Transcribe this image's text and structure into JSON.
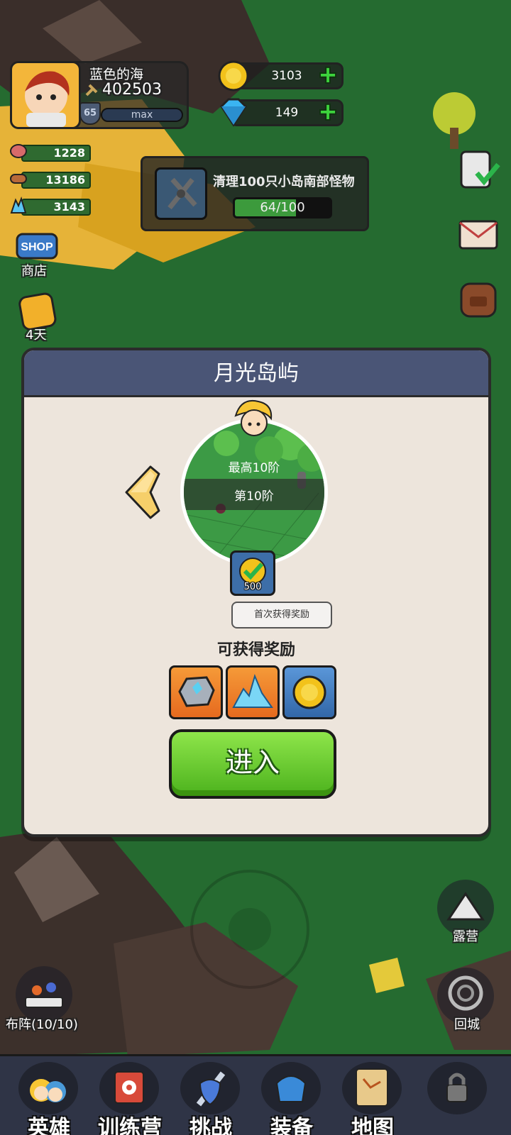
{
  "player": {
    "name": "蓝色的海",
    "power": "402503",
    "level": "65",
    "exp_label": "max"
  },
  "currencies": {
    "gold": "3103",
    "gems": "149"
  },
  "resources": [
    {
      "value": "1228",
      "icon": "meat-icon"
    },
    {
      "value": "13186",
      "icon": "wood-icon"
    },
    {
      "value": "3143",
      "icon": "crystal-icon"
    }
  ],
  "quest": {
    "title": "清理100只小岛南部怪物",
    "progress_label": "64/100",
    "progress_fraction": 0.64
  },
  "side_left": {
    "shop_label": "商店",
    "pass_label": "4天"
  },
  "side_right": {
    "camp_label": "露营",
    "return_label": "回城"
  },
  "formation_label": "布阵(10/10)",
  "modal": {
    "title": "月光岛屿",
    "max_stage": "最高10阶",
    "current_stage": "第10阶",
    "first_reward_count": "500",
    "first_reward_label": "首次获得奖励",
    "rewards_title": "可获得奖励",
    "rewards": [
      {
        "icon": "stone-icon",
        "tile": "orange"
      },
      {
        "icon": "crystal-pile-icon",
        "tile": "orange"
      },
      {
        "icon": "gold-coin-icon",
        "tile": "blue"
      }
    ],
    "enter_label": "进入"
  },
  "nav": [
    {
      "label": "英雄",
      "icon": "heroes-icon"
    },
    {
      "label": "训练营",
      "icon": "training-icon"
    },
    {
      "label": "挑战",
      "icon": "sword-shield-icon"
    },
    {
      "label": "装备",
      "icon": "equipment-icon"
    },
    {
      "label": "地图",
      "icon": "map-icon"
    },
    {
      "label": "",
      "icon": "locked-icon"
    }
  ]
}
